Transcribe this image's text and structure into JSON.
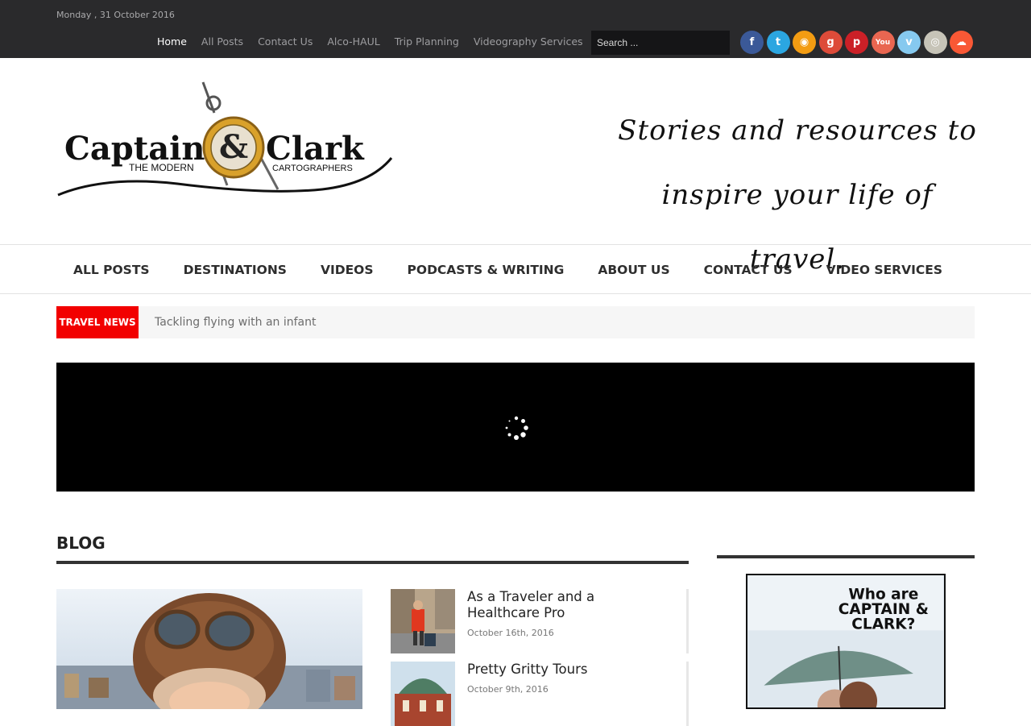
{
  "topbar": {
    "date": "Monday , 31 October 2016",
    "nav": [
      "Home",
      "All Posts",
      "Contact Us",
      "Alco-HAUL",
      "Trip Planning",
      "Videography Services"
    ],
    "search_placeholder": "Search ...",
    "social": [
      {
        "icon": "facebook-icon",
        "glyph": "f",
        "color": "#3b5998"
      },
      {
        "icon": "twitter-icon",
        "glyph": "t",
        "color": "#2ba6e1"
      },
      {
        "icon": "rss-icon",
        "glyph": "◉",
        "color": "#f39c12"
      },
      {
        "icon": "google-plus-icon",
        "glyph": "g",
        "color": "#dd4b39"
      },
      {
        "icon": "pinterest-icon",
        "glyph": "p",
        "color": "#cb2027"
      },
      {
        "icon": "youtube-icon",
        "glyph": "You",
        "color": "#e96651"
      },
      {
        "icon": "vimeo-icon",
        "glyph": "v",
        "color": "#86c9ef"
      },
      {
        "icon": "instagram-icon",
        "glyph": "◎",
        "color": "#c7c4b8"
      },
      {
        "icon": "soundcloud-icon",
        "glyph": "☁",
        "color": "#f95835"
      }
    ]
  },
  "header": {
    "logo_title_left": "Captain",
    "logo_amp": "&",
    "logo_title_right": "Clark",
    "logo_sub_left": "THE MODERN",
    "logo_sub_right": "CARTOGRAPHERS",
    "tagline_line1": "Stories and resources to",
    "tagline_line2": "inspire your life of travel."
  },
  "mainnav": [
    "ALL POSTS",
    "DESTINATIONS",
    "VIDEOS",
    "PODCASTS & WRITING",
    "ABOUT US",
    "CONTACT US",
    "VIDEO SERVICES"
  ],
  "ticker": {
    "label": "TRAVEL NEWS",
    "text": "Tackling flying with an infant"
  },
  "blog": {
    "heading": "BLOG",
    "posts": [
      {
        "title": "As a Traveler and a Healthcare Pro",
        "date": "October 16th, 2016"
      },
      {
        "title": "Pretty Gritty Tours",
        "date": "October 9th, 2016"
      }
    ]
  },
  "sidebar": {
    "promo_line1": "Who are",
    "promo_line2": "CAPTAIN &",
    "promo_line3": "CLARK?"
  }
}
